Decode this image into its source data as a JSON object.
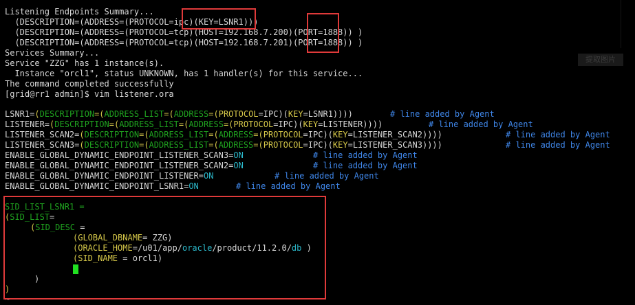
{
  "terminal": {
    "status": [
      "Listening Endpoints Summary...",
      "  (DESCRIPTION=(ADDRESS=(PROTOCOL=ipc)(KEY=LSNR1)))",
      "  (DESCRIPTION=(ADDRESS=(PROTOCOL=tcp)(HOST=192.168.7.200)(PORT=1888)) )",
      "  (DESCRIPTION=(ADDRESS=(PROTOCOL=tcp)(HOST=192.168.7.201)(PORT=1888)) )",
      "Services Summary...",
      "Service \"ZZG\" has 1 instance(s).",
      "  Instance \"orcl1\", status UNKNOWN, has 1 handler(s) for this service...",
      "The command completed successfully",
      "[grid@rr1 admin]$ vim listener.ora"
    ],
    "listener_lines": {
      "l1": {
        "name": "LSNR1=",
        "p1": "(",
        "k1": "DESCRIPTION",
        "p2": "=(",
        "k2": "ADDRESS_LIST",
        "p3": "=(",
        "k3": "ADDRESS",
        "p4": "=(",
        "k4": "PROTOCOL",
        "p5": "=",
        "v1": "IPC",
        "p6": ")(",
        "k5": "KEY",
        "p7": "=LSNR1))))"
      },
      "l2": {
        "name": "LISTENER=",
        "p1": "(",
        "k1": "DESCRIPTION",
        "p2": "=(",
        "k2": "ADDRESS_LIST",
        "p3": "=(",
        "k3": "ADDRESS",
        "p4": "=(",
        "k4": "PROTOCOL",
        "p5": "=",
        "v1": "IPC",
        "p6": ")(",
        "k5": "KEY",
        "p7": "=LISTENER))))"
      },
      "l3": {
        "name": "LISTENER_SCAN2=",
        "p1": "(",
        "k1": "DESCRIPTION",
        "p2": "=(",
        "k2": "ADDRESS_LIST",
        "p3": "=(",
        "k3": "ADDRESS",
        "p4": "=(",
        "k4": "PROTOCOL",
        "p5": "=",
        "v1": "IPC",
        "p6": ")(",
        "k5": "KEY",
        "p7": "=LISTENER_SCAN2))))"
      },
      "l4": {
        "name": "LISTENER_SCAN3=",
        "p1": "(",
        "k1": "DESCRIPTION",
        "p2": "=(",
        "k2": "ADDRESS_LIST",
        "p3": "=(",
        "k3": "ADDRESS",
        "p4": "=(",
        "k4": "PROTOCOL",
        "p5": "=",
        "v1": "IPC",
        "p6": ")(",
        "k5": "KEY",
        "p7": "=LISTENER_SCAN3))))"
      }
    },
    "enable_lines": [
      {
        "name": "ENABLE_GLOBAL_DYNAMIC_ENDPOINT_LISTENER_SCAN3=",
        "val": "ON"
      },
      {
        "name": "ENABLE_GLOBAL_DYNAMIC_ENDPOINT_LISTENER_SCAN2=",
        "val": "ON"
      },
      {
        "name": "ENABLE_GLOBAL_DYNAMIC_ENDPOINT_LISTENER=",
        "val": "ON"
      },
      {
        "name": "ENABLE_GLOBAL_DYNAMIC_ENDPOINT_LSNR1=",
        "val": "ON"
      }
    ],
    "comment": "# line added by Agent",
    "sid": {
      "l1": "SID_LIST_LSNR1 =",
      "l2a": "(",
      "l2b": "SID_LIST",
      "l2c": "=",
      "l3a": "(",
      "l3b": "SID_DESC",
      "l3c": " =",
      "l4a": "(",
      "l4b": "GLOBAL_DBNAME",
      "l4c": "= ZZG)",
      "l5a": "(",
      "l5b": "ORACLE_HOME",
      "l5c": "=/u01/app/",
      "l5d": "oracle",
      "l5e": "/product/11.2.0/",
      "l5f": "db",
      "l5g": " )",
      "l6a": "(",
      "l6b": "SID_NAME",
      "l6c": " = orcl1)",
      "l8": ")",
      "l9": ")",
      "tilde": "~"
    },
    "ghost_button": "提取图片"
  },
  "colors": {
    "highlight_box": "#e03a3a",
    "cursor": "#21e021",
    "keyword": "#1fa31f",
    "operator": "#d7c94a",
    "value": "#2bb7c9",
    "comment": "#3f86e8"
  }
}
